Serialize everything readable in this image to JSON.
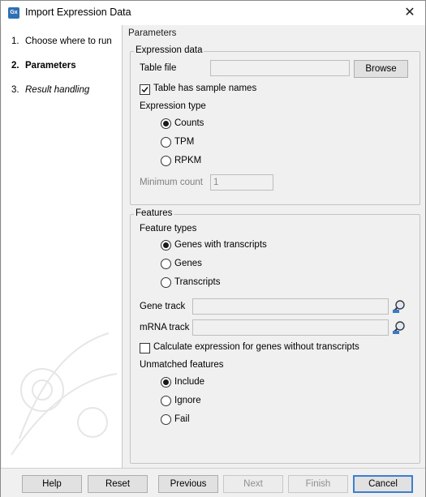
{
  "window": {
    "title": "Import Expression Data",
    "icon_text": "Gx"
  },
  "sidebar": {
    "steps": [
      {
        "num": "1.",
        "label": "Choose where to run"
      },
      {
        "num": "2.",
        "label": "Parameters"
      },
      {
        "num": "3.",
        "label": "Result handling"
      }
    ]
  },
  "page": {
    "header": "Parameters"
  },
  "expression_data": {
    "title": "Expression data",
    "table_file_label": "Table file",
    "table_file_value": "",
    "browse_label": "Browse",
    "sample_names_label": "Table has sample names",
    "sample_names_checked": true,
    "expression_type_label": "Expression type",
    "types": [
      "Counts",
      "TPM",
      "RPKM"
    ],
    "selected_type": "Counts",
    "min_count_label": "Minimum count",
    "min_count_value": "1"
  },
  "features": {
    "title": "Features",
    "feature_types_label": "Feature types",
    "types": [
      "Genes with transcripts",
      "Genes",
      "Transcripts"
    ],
    "selected_type": "Genes with transcripts",
    "gene_track_label": "Gene track",
    "gene_track_value": "",
    "mrna_track_label": "mRNA track",
    "mrna_track_value": "",
    "calc_label": "Calculate expression for genes without transcripts",
    "calc_checked": false,
    "unmatched_label": "Unmatched features",
    "unmatched": [
      "Include",
      "Ignore",
      "Fail"
    ],
    "selected_unmatched": "Include"
  },
  "footer": {
    "help": "Help",
    "reset": "Reset",
    "previous": "Previous",
    "next": "Next",
    "finish": "Finish",
    "cancel": "Cancel"
  }
}
